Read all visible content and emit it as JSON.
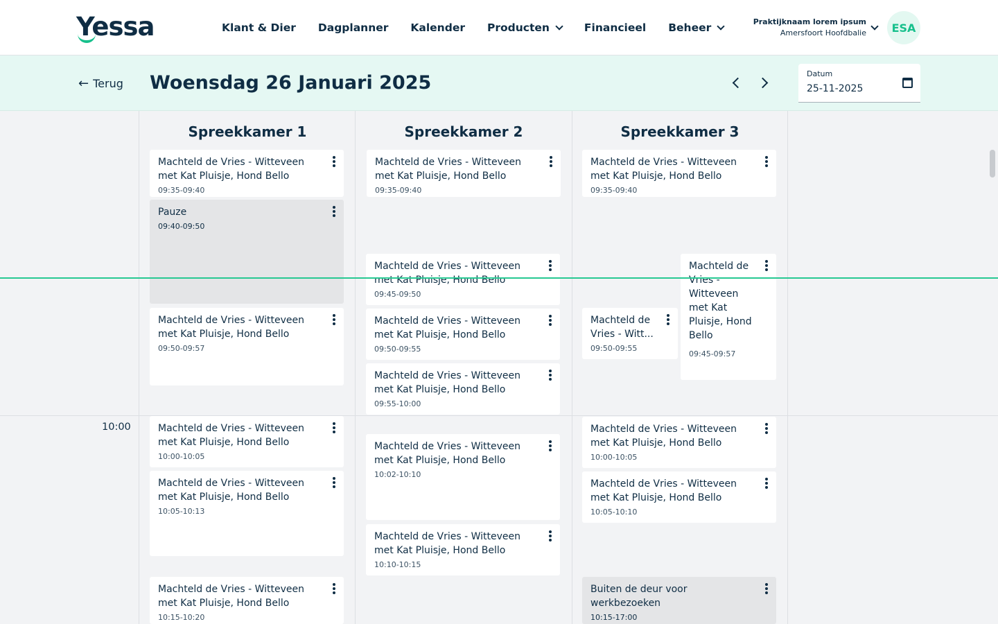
{
  "brand": {
    "logo_text": "Yessa"
  },
  "nav": {
    "items": [
      {
        "label": "Klant & Dier",
        "dropdown": false
      },
      {
        "label": "Dagplanner",
        "dropdown": false
      },
      {
        "label": "Kalender",
        "dropdown": false
      },
      {
        "label": "Producten",
        "dropdown": true
      },
      {
        "label": "Financieel",
        "dropdown": false
      },
      {
        "label": "Beheer",
        "dropdown": true
      }
    ]
  },
  "practice": {
    "name": "Praktijknaam lorem ipsum",
    "location": "Amersfoort Hoofdbalie"
  },
  "user": {
    "initials": "ESA"
  },
  "subheader": {
    "back_label": "Terug",
    "title": "Woensdag 26 Januari 2025",
    "date_label": "Datum",
    "date_value": "25-11-2025"
  },
  "colors": {
    "accent": "#17c08c",
    "now_line": "#26c892",
    "header_tint": "#e5f8f3",
    "text": "#0f2d44"
  },
  "time_labels": [
    "10:00"
  ],
  "rooms": [
    {
      "name": "Spreekkamer 1",
      "appointments": [
        {
          "title": "Machteld de Vries - Witteveen met Kat Pluisje, Hond Bello",
          "time": "09:35-09:40"
        },
        {
          "title": "Pauze",
          "time": "09:40-09:50",
          "kind": "block"
        },
        {
          "title": "Machteld de Vries - Witteveen met Kat Pluisje, Hond Bello",
          "time": "09:50-09:57"
        },
        {
          "title": "Machteld de Vries - Witteveen met Kat Pluisje, Hond Bello",
          "time": "10:00-10:05"
        },
        {
          "title": "Machteld de Vries - Witteveen met Kat Pluisje, Hond Bello",
          "time": "10:05-10:13"
        },
        {
          "title": "Machteld de Vries - Witteveen met Kat Pluisje, Hond Bello",
          "time": "10:15-10:20"
        }
      ]
    },
    {
      "name": "Spreekkamer 2",
      "appointments": [
        {
          "title": "Machteld de Vries - Witteveen met Kat Pluisje, Hond Bello",
          "time": "09:35-09:40"
        },
        {
          "title": "Machteld de Vries - Witteveen met Kat Pluisje, Hond Bello",
          "time": "09:45-09:50"
        },
        {
          "title": "Machteld de Vries - Witteveen met Kat Pluisje, Hond Bello",
          "time": "09:50-09:55"
        },
        {
          "title": "Machteld de Vries - Witteveen met Kat Pluisje, Hond Bello",
          "time": "09:55-10:00"
        },
        {
          "title": "Machteld de Vries - Witteveen met Kat Pluisje, Hond Bello",
          "time": "10:02-10:10"
        },
        {
          "title": "Machteld de Vries - Witteveen met Kat Pluisje, Hond Bello",
          "time": "10:10-10:15"
        }
      ]
    },
    {
      "name": "Spreekkamer 3",
      "appointments": [
        {
          "title": "Machteld de Vries - Witteveen met Kat Pluisje, Hond Bello",
          "time": "09:35-09:40"
        },
        {
          "title": "Machteld de Vries - Witteveen met Kat Pluisje, Hond Bello",
          "time": "09:45-09:57"
        },
        {
          "title": "Machteld de Vries - Witt...",
          "time": "09:50-09:55"
        },
        {
          "title": "Machteld de Vries - Witteveen met Kat Pluisje, Hond Bello",
          "time": "10:00-10:05"
        },
        {
          "title": "Machteld de Vries - Witteveen met Kat Pluisje, Hond Bello",
          "time": "10:05-10:10"
        },
        {
          "title": "Buiten de deur voor werkbezoeken",
          "time": "10:15-17:00",
          "kind": "block"
        }
      ]
    }
  ]
}
